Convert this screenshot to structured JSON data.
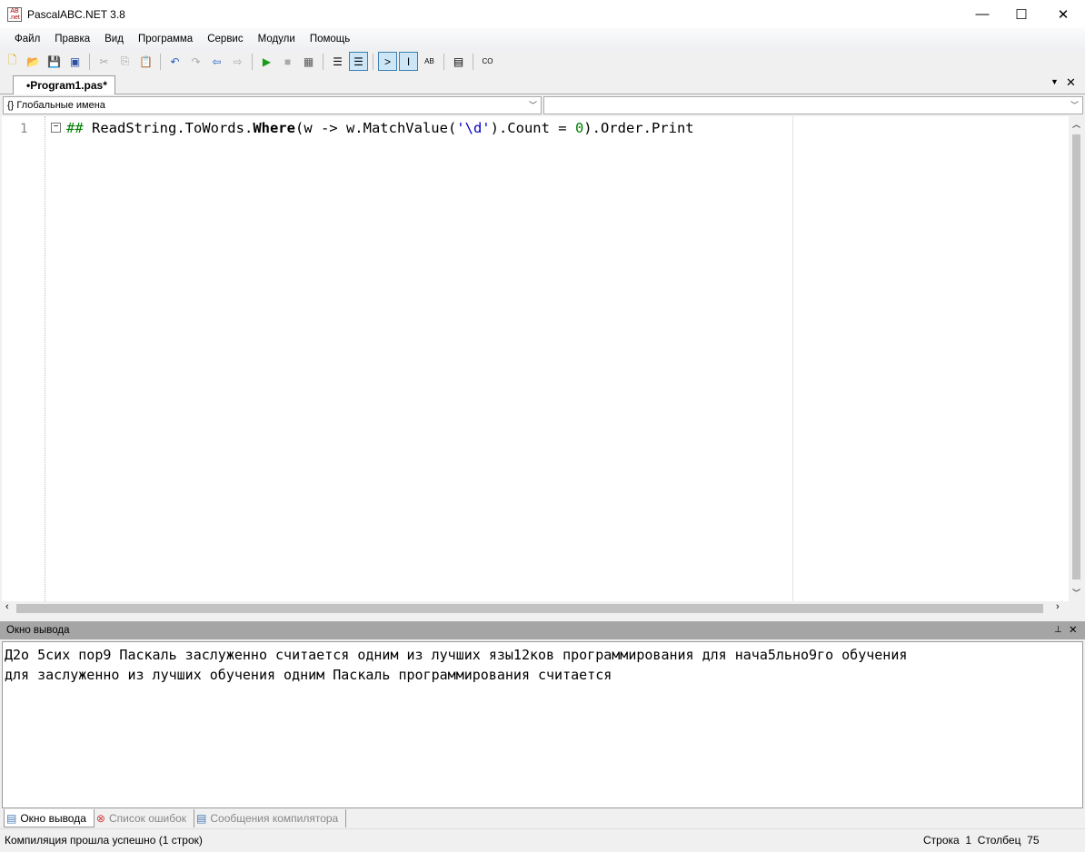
{
  "window": {
    "title": "PascalABC.NET 3.8",
    "minimize": "—",
    "maximize": "☐",
    "close": "✕"
  },
  "menu": [
    "Файл",
    "Правка",
    "Вид",
    "Программа",
    "Сервис",
    "Модули",
    "Помощь"
  ],
  "toolbar_icons": [
    "new-file",
    "open",
    "save",
    "save-all",
    "cut",
    "copy",
    "paste",
    "undo",
    "redo",
    "to-up",
    "to-down",
    "run",
    "stop",
    "debug",
    "output-panel",
    "console-mode",
    "terminal",
    "text",
    "abc",
    "page",
    "code"
  ],
  "tab": {
    "label": "•Program1.pas*",
    "dropdown": "▼",
    "close": "✕"
  },
  "combos": {
    "left": "Глобальные имена",
    "right": ""
  },
  "editor": {
    "line_number": "1",
    "code": {
      "hash": "##",
      "p1": " ReadString.ToWords.",
      "kw": "Where",
      "p2": "(w -> w.MatchValue(",
      "str": "'\\d'",
      "p3": ").Count = ",
      "num": "0",
      "p4": ").Order.Print"
    }
  },
  "output": {
    "title": "Окно вывода",
    "pin": "📌",
    "close": "✕",
    "lines": [
      "Д2о 5сих пор9 Паскаль заслуженно считается одним из лучших язы12ков программирования для нача5льно9го обучения",
      "для заслуженно из лучших обучения одним Паскаль программирования считается"
    ]
  },
  "bottom_tabs": [
    "Окно вывода",
    "Список ошибок",
    "Сообщения компилятора"
  ],
  "status": {
    "message": "Компиляция прошла успешно (1 строк)",
    "row_label": "Строка",
    "row": "1",
    "col_label": "Столбец",
    "col": "75"
  },
  "colors": {
    "keyword": "#000000",
    "string": "#0000c0",
    "number": "#008000",
    "hash": "#008000"
  }
}
